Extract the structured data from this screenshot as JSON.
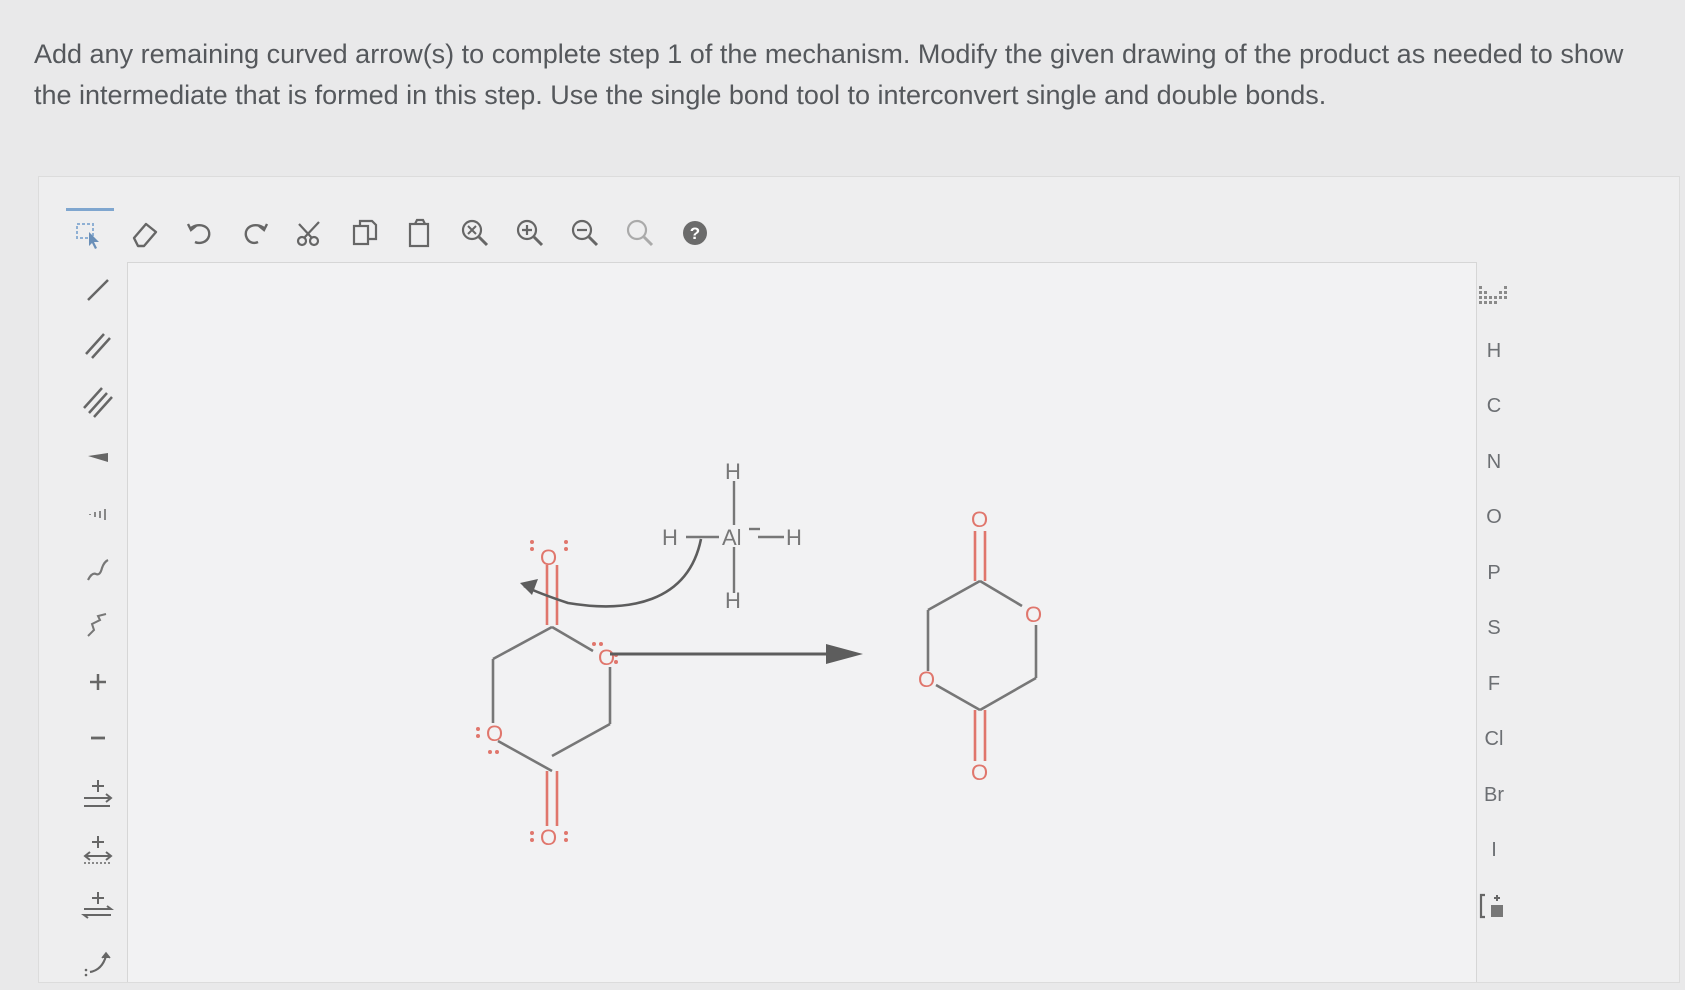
{
  "question": {
    "text": "Add any remaining curved arrow(s) to complete step 1 of the mechanism. Modify the given drawing of the product as needed to show the intermediate that is formed in this step. Use the single bond tool to interconvert single and double bonds."
  },
  "top_toolbar": [
    {
      "name": "select-tool-icon"
    },
    {
      "name": "eraser-icon"
    },
    {
      "name": "undo-icon"
    },
    {
      "name": "redo-icon"
    },
    {
      "name": "cut-icon"
    },
    {
      "name": "copy-icon"
    },
    {
      "name": "paste-icon"
    },
    {
      "name": "zoom-reset-icon"
    },
    {
      "name": "zoom-in-icon"
    },
    {
      "name": "zoom-out-icon"
    },
    {
      "name": "zoom-fit-icon"
    },
    {
      "name": "help-icon"
    }
  ],
  "left_toolbar": [
    {
      "name": "single-bond-icon"
    },
    {
      "name": "double-bond-icon"
    },
    {
      "name": "triple-bond-icon"
    },
    {
      "name": "wedge-bond-icon"
    },
    {
      "name": "hash-bond-icon"
    },
    {
      "name": "wavy-bond-icon"
    },
    {
      "name": "chain-tool-icon"
    },
    {
      "name": "positive-charge-icon"
    },
    {
      "name": "negative-charge-icon"
    },
    {
      "name": "reaction-arrow-icon"
    },
    {
      "name": "resonance-arrow-icon"
    },
    {
      "name": "equilibrium-arrow-icon"
    },
    {
      "name": "curved-arrow-icon"
    }
  ],
  "right_toolbar": {
    "periodic_table_icon": "periodic-table-icon",
    "elements": [
      "H",
      "C",
      "N",
      "O",
      "P",
      "S",
      "F",
      "Cl",
      "Br",
      "I"
    ],
    "bracket_icon": "bracket-tool-icon"
  },
  "drawing": {
    "reactant_atoms": {
      "o_top": "O",
      "o_ring_right": "O",
      "o_ring_left": "O",
      "o_bottom": "O"
    },
    "reagent": {
      "al": "Al",
      "h_top": "H",
      "h_left": "H",
      "h_right": "H",
      "h_bottom": "H"
    },
    "product_atoms": {
      "o_top": "O",
      "o_ring_right": "O",
      "o_ring_left": "O",
      "o_bottom": "O"
    }
  },
  "colors": {
    "oxygen": "#e0766c",
    "bond": "#777777",
    "arrow": "#5d5d5d",
    "text": "#55585c",
    "accent": "#7fa6cf",
    "help": "#6b6b6b"
  }
}
